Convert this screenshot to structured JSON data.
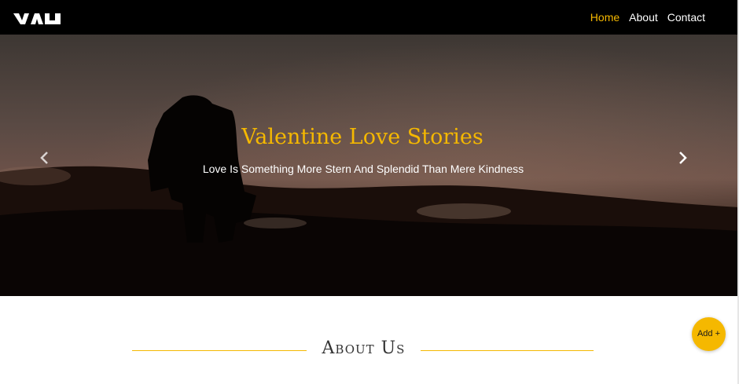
{
  "brand": {
    "logo_icon": "brand-logo-icon"
  },
  "nav": {
    "items": [
      {
        "label": "Home",
        "active": true
      },
      {
        "label": "About",
        "active": false
      },
      {
        "label": "Contact",
        "active": false
      }
    ],
    "active_color": "#f5b800"
  },
  "hero": {
    "title": "Valentine Love Stories",
    "subtitle": "Love Is Something More Stern And Splendid Than Mere Kindness",
    "prev_icon": "chevron-left-icon",
    "next_icon": "chevron-right-icon"
  },
  "about": {
    "heading": "About Us"
  },
  "fab": {
    "label": "Add +"
  },
  "colors": {
    "accent": "#f5b800",
    "nav_bg": "#000000"
  }
}
